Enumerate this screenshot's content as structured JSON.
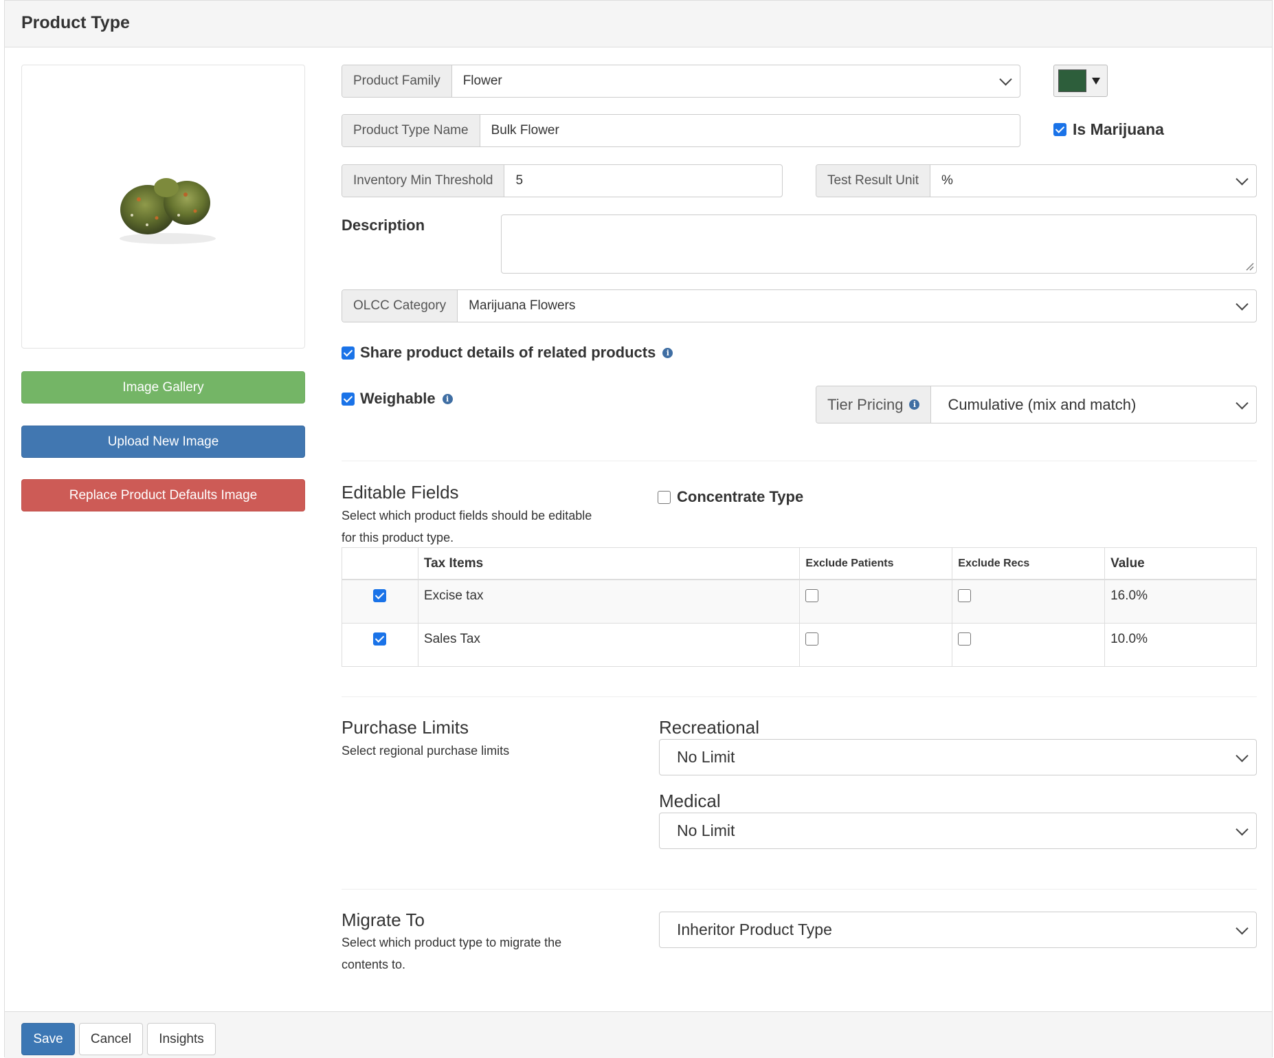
{
  "header": {
    "title": "Product Type"
  },
  "image_panel": {
    "image_alt": "cannabis-bud-image",
    "gallery_label": "Image Gallery",
    "upload_label": "Upload New Image",
    "replace_label": "Replace Product Defaults Image"
  },
  "form": {
    "product_family": {
      "label": "Product Family",
      "value": "Flower"
    },
    "color": {
      "value": "#2d5e3b"
    },
    "product_type_name": {
      "label": "Product Type Name",
      "value": "Bulk Flower"
    },
    "is_marijuana": {
      "label": "Is Marijuana",
      "checked": true
    },
    "inventory_min_threshold": {
      "label": "Inventory Min Threshold",
      "value": "5"
    },
    "test_result_unit": {
      "label": "Test Result Unit",
      "value": "%"
    },
    "description": {
      "label": "Description",
      "value": ""
    },
    "olcc_category": {
      "label": "OLCC Category",
      "value": "Marijuana Flowers"
    },
    "share_details": {
      "label": "Share product details of related products",
      "checked": true
    },
    "weighable": {
      "label": "Weighable",
      "checked": true
    },
    "tier_pricing": {
      "label": "Tier Pricing",
      "value": "Cumulative (mix and match)"
    }
  },
  "editable_fields": {
    "title": "Editable Fields",
    "subtitle_line1": "Select which product fields should be editable",
    "subtitle_line2": "for this product type.",
    "concentrate_type": {
      "label": "Concentrate Type",
      "checked": false
    }
  },
  "tax_table": {
    "headers": {
      "items": "Tax Items",
      "exclude_patients": "Exclude Patients",
      "exclude_recs": "Exclude Recs",
      "value": "Value"
    },
    "rows": [
      {
        "checked": true,
        "name": "Excise tax",
        "exclude_patients": false,
        "exclude_recs": false,
        "value": "16.0%"
      },
      {
        "checked": true,
        "name": "Sales Tax",
        "exclude_patients": false,
        "exclude_recs": false,
        "value": "10.0%"
      }
    ]
  },
  "purchase_limits": {
    "title": "Purchase Limits",
    "subtitle": "Select regional purchase limits",
    "recreational": {
      "label": "Recreational",
      "value": "No Limit"
    },
    "medical": {
      "label": "Medical",
      "value": "No Limit"
    }
  },
  "migrate": {
    "title": "Migrate To",
    "subtitle_line1": "Select which product type to migrate the",
    "subtitle_line2": "contents to.",
    "select_value": "Inheritor Product Type"
  },
  "footer": {
    "save_label": "Save",
    "cancel_label": "Cancel",
    "insights_label": "Insights"
  },
  "colors": {
    "green": "#74b566",
    "blue": "#4177b1",
    "red": "#cd5b56",
    "checkbox": "#1a73e8",
    "info": "#3f6ea3"
  }
}
